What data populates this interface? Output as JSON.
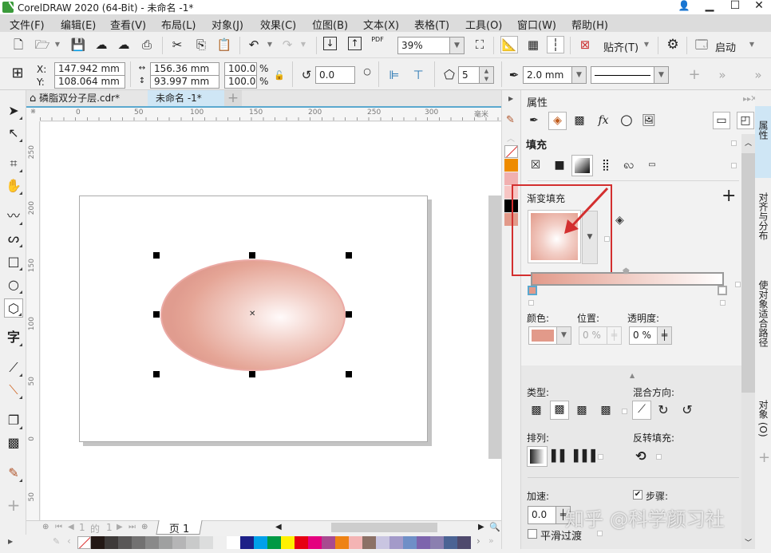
{
  "window": {
    "title": "CorelDRAW 2020 (64-Bit) - 未命名 -1*",
    "controls": {
      "minimize": "▁",
      "maximize": "☐",
      "close": "✕"
    }
  },
  "menu": [
    "文件(F)",
    "编辑(E)",
    "查看(V)",
    "布局(L)",
    "对象(J)",
    "效果(C)",
    "位图(B)",
    "文本(X)",
    "表格(T)",
    "工具(O)",
    "窗口(W)",
    "帮助(H)"
  ],
  "toolbar": {
    "zoom_value": "39%",
    "snap_label": "贴齐(T)",
    "launch_label": "启动",
    "pdf_label": "PDF"
  },
  "propbar": {
    "x_label": "X:",
    "y_label": "Y:",
    "x_value": "147.942 mm",
    "y_value": "108.064 mm",
    "width_value": "156.36 mm",
    "height_value": "93.997 mm",
    "scale_w": "100.0",
    "scale_h": "100.0",
    "percent": "%",
    "rotation": "0.0",
    "sides": "5",
    "outline_width": "2.0 mm"
  },
  "tabs": [
    {
      "label": "磷脂双分子层.cdr*",
      "active": false
    },
    {
      "label": "未命名 -1*",
      "active": true
    }
  ],
  "ruler": {
    "h_ticks": [
      "0",
      "50",
      "100",
      "150",
      "200",
      "250",
      "300"
    ],
    "v_ticks": [
      "250",
      "200",
      "150",
      "100",
      "50",
      "0",
      "50"
    ],
    "unit": "毫米"
  },
  "page_nav": {
    "current": "1",
    "of_label": "的",
    "total": "1",
    "page_tab": "页 1"
  },
  "palette_colors": [
    "#231815",
    "#3e3a39",
    "#595757",
    "#727171",
    "#898989",
    "#9fa0a0",
    "#b5b5b6",
    "#c9caca",
    "#dcdddd",
    "#efefef",
    "#ffffff",
    "#1d2088",
    "#00a0e9",
    "#009944",
    "#fff100",
    "#e60012",
    "#e4007f",
    "#a84a90",
    "#ee8214",
    "#f4b4b4",
    "#8c7166",
    "#c9c5e1",
    "#a39ac9",
    "#6f8fc7",
    "#7d64ad",
    "#8b7fb0",
    "#4b6394",
    "#4f4a6d"
  ],
  "doc_palette": [
    "none",
    "#ee8b00",
    "#f1b0b0",
    "#f7c5c3",
    "#000000",
    "#e29a8a"
  ],
  "docker": {
    "title": "属性",
    "fill_heading": "填充",
    "gradient_heading": "渐变填充",
    "color_label": "颜色:",
    "position_label": "位置:",
    "transparency_label": "透明度:",
    "position_value": "0 %",
    "transparency_value": "0 %",
    "stop_color": "#e29a8a",
    "type_label": "类型:",
    "blend_label": "混合方向:",
    "arrange_label": "排列:",
    "reverse_label": "反转填充:",
    "accel_label": "加速:",
    "accel_value": "0.0",
    "steps_label": "步骤:",
    "steps_checked": true,
    "smooth_label": "平滑过渡",
    "smooth_checked": false
  },
  "docker_tabs": [
    "属性",
    "对齐与分布",
    "使对象适合路径",
    "对象 (O)"
  ],
  "watermark": "知乎 @科学颜习社"
}
